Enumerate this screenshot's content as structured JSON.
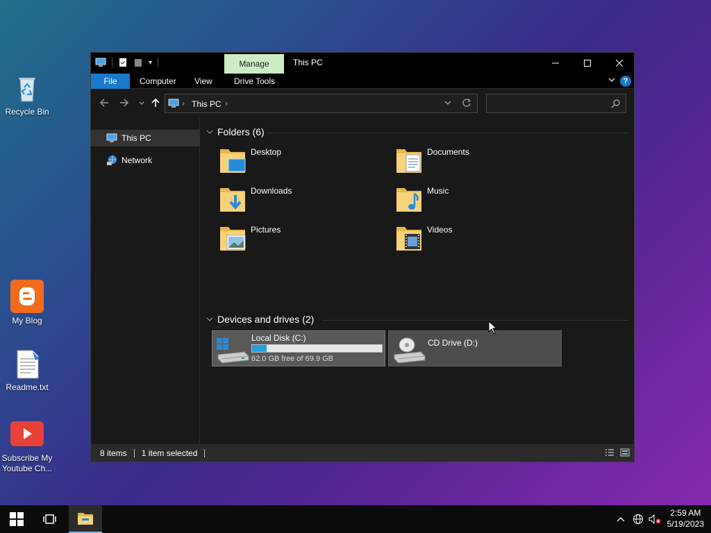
{
  "desktop": {
    "icons": [
      {
        "label": "Recycle Bin"
      },
      {
        "label": "My Blog"
      },
      {
        "label": "Readme.txt"
      },
      {
        "label": "Subscribe My Youtube Ch..."
      }
    ]
  },
  "window": {
    "title": "This PC",
    "manage_tab": "Manage",
    "ribbon_tabs": [
      "File",
      "Computer",
      "View",
      "Drive Tools"
    ],
    "help": "?",
    "address": {
      "crumb": "This PC",
      "search_placeholder": ""
    },
    "nav_pane": [
      {
        "label": "This PC",
        "selected": true
      },
      {
        "label": "Network",
        "selected": false
      }
    ],
    "folders_header": "Folders (6)",
    "folders": [
      {
        "label": "Desktop"
      },
      {
        "label": "Documents"
      },
      {
        "label": "Downloads"
      },
      {
        "label": "Music"
      },
      {
        "label": "Pictures"
      },
      {
        "label": "Videos"
      }
    ],
    "drives_header": "Devices and drives (2)",
    "drives": [
      {
        "name": "Local Disk (C:)",
        "free_text": "62.0 GB free of 69.9 GB",
        "used_fraction": 0.113
      },
      {
        "name": "CD Drive (D:)"
      }
    ],
    "status": {
      "items": "8 items",
      "selected": "1 item selected"
    }
  },
  "taskbar": {
    "time": "2:59 AM",
    "date": "5/19/2023"
  },
  "colors": {
    "accent": "#1979ca",
    "manage": "#cdecc4",
    "drive_bar": "#26a0da"
  }
}
